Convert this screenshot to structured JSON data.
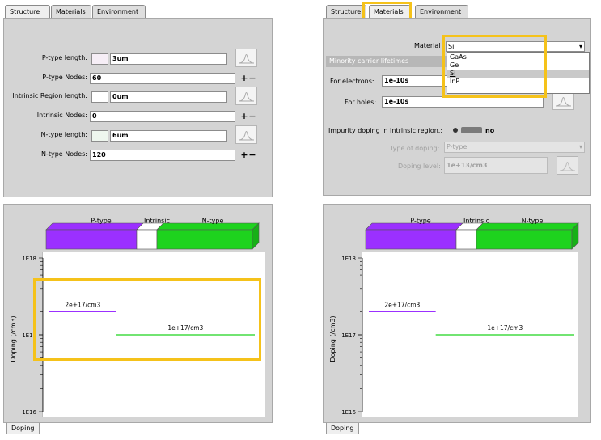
{
  "left": {
    "tabs": [
      "Structure",
      "Materials",
      "Environment"
    ],
    "fields": [
      {
        "label": "P-type length:",
        "value": "3um",
        "swatch": "#f6eef6"
      },
      {
        "label": "P-type Nodes:",
        "value": "60"
      },
      {
        "label": "Intrinsic Region length:",
        "value": "0um",
        "swatch": "#ffffff"
      },
      {
        "label": "Intrinsic Nodes:",
        "value": "0"
      },
      {
        "label": "N-type length:",
        "value": "6um",
        "swatch": "#eef6ee"
      },
      {
        "label": "N-type Nodes:",
        "value": "120"
      }
    ],
    "plus": "+",
    "minus": "−",
    "bottom_tab": "Doping"
  },
  "right": {
    "tabs": [
      "Structure",
      "Materials",
      "Environment"
    ],
    "material_label": "Material",
    "material_value": "Si",
    "material_options": [
      "GaAs",
      "Ge",
      "Si",
      "InP"
    ],
    "lifetimes_header": "Minority carrier lifetimes",
    "electrons_label": "For electrons:",
    "electrons_value": "1e-10s",
    "holes_label": "For holes:",
    "holes_value": "1e-10s",
    "impurity_label": "Impurity doping in Intrinsic region.:",
    "impurity_value": "no",
    "doping_type_label": "Type of doping:",
    "doping_type_value": "P-type",
    "doping_level_label": "Doping level:",
    "doping_level_value": "1e+13/cm3",
    "bottom_tab": "Doping"
  },
  "colors": {
    "p_type": "#9b30ff",
    "intrinsic": "#ffffff",
    "n_type": "#1ed31e",
    "highlight": "#f5c21a"
  },
  "chart_data": {
    "type": "line",
    "regions": [
      "P-type",
      "Intrinsic",
      "N-type"
    ],
    "ylabel": "Doping (/cm3)",
    "yscale": "log",
    "yticks": [
      "1E18",
      "1E17",
      "1E16"
    ],
    "ylim": [
      1e+16,
      1e+18
    ],
    "series": [
      {
        "name": "P-type",
        "label": "2e+17/cm3",
        "value": 2e+17,
        "x_range": [
          0,
          3
        ]
      },
      {
        "name": "N-type",
        "label": "1e+17/cm3",
        "value": 1e+17,
        "x_range": [
          3,
          9
        ]
      }
    ]
  }
}
